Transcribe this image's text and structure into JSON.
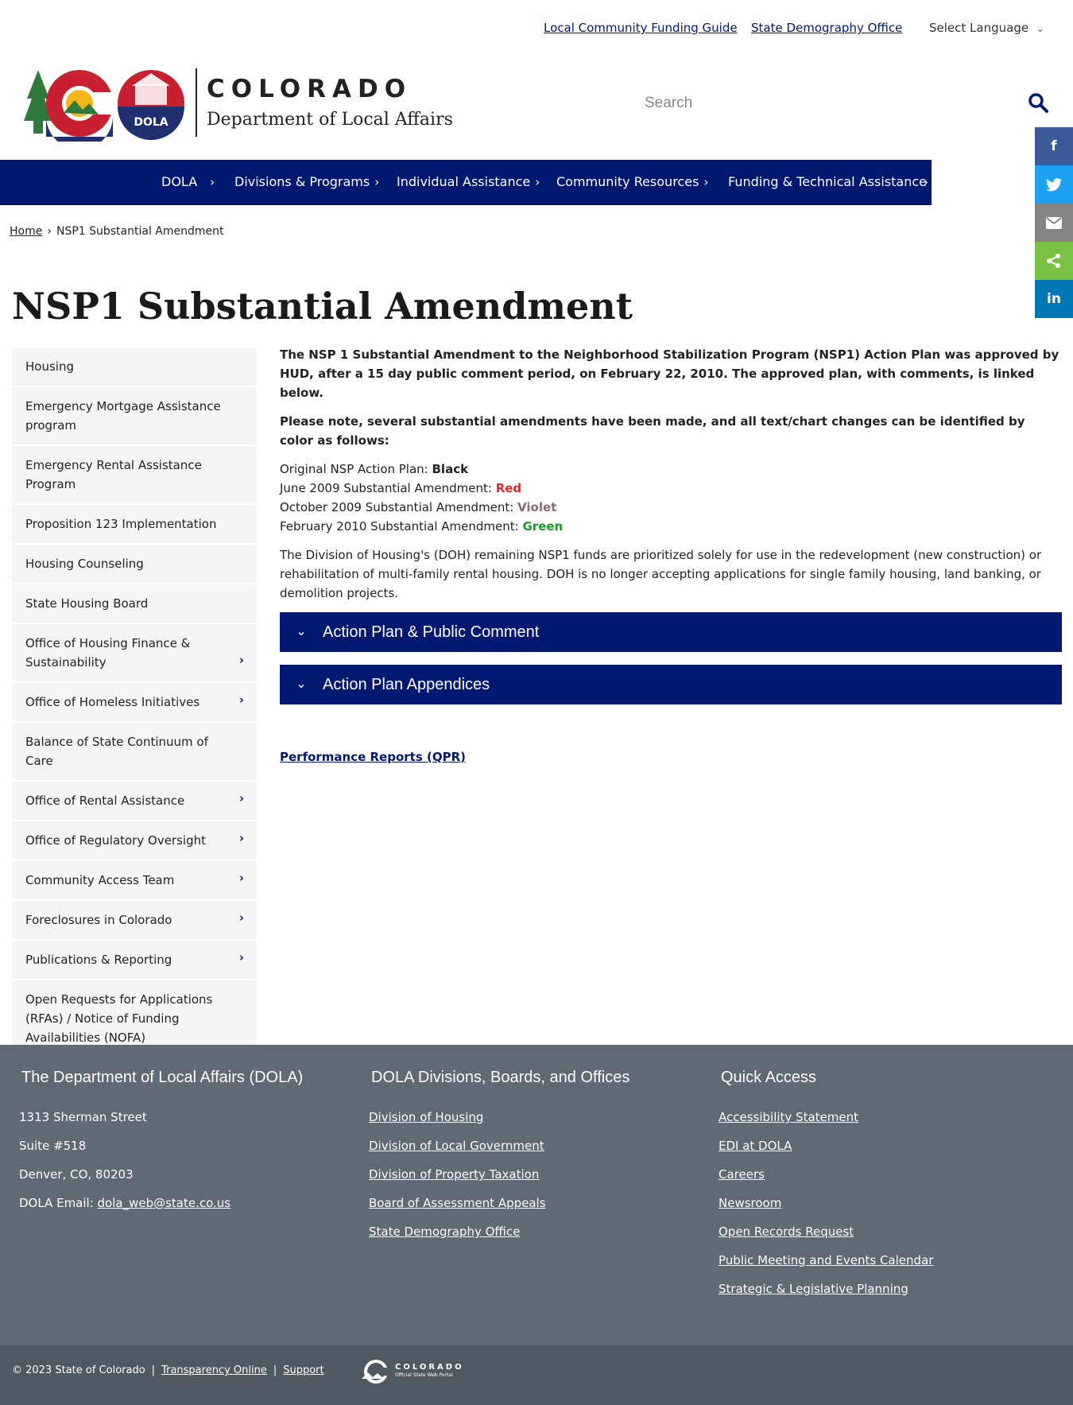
{
  "utility": {
    "link1": "Local Community Funding Guide",
    "link2": "State Demography Office",
    "language": "Select Language"
  },
  "header": {
    "logo_title": "COLORADO",
    "logo_subtitle": "Department of Local Affairs",
    "logo_badge": "DOLA",
    "search_placeholder": "Search"
  },
  "nav": {
    "items": [
      {
        "label": "DOLA"
      },
      {
        "label": "Divisions & Programs"
      },
      {
        "label": "Individual Assistance"
      },
      {
        "label": "Community Resources"
      },
      {
        "label": "Funding & Technical Assistance"
      }
    ]
  },
  "share": {
    "facebook": "f",
    "linkedin": "in"
  },
  "breadcrumb": {
    "home": "Home",
    "current": "NSP1 Substantial Amendment"
  },
  "page_title": "NSP1 Substantial Amendment",
  "sidemenu": {
    "items": [
      {
        "label": "Housing"
      },
      {
        "label": "Emergency Mortgage Assistance program"
      },
      {
        "label": "Emergency Rental Assistance Program"
      },
      {
        "label": "Proposition 123 Implementation"
      },
      {
        "label": "Housing Counseling"
      },
      {
        "label": "State Housing Board"
      },
      {
        "label": "Office of Housing Finance & Sustainability"
      },
      {
        "label": "Office of Homeless Initiatives"
      },
      {
        "label": "Balance of State Continuum of Care"
      },
      {
        "label": "Office of Rental Assistance"
      },
      {
        "label": "Office of Regulatory Oversight"
      },
      {
        "label": "Community Access Team"
      },
      {
        "label": "Foreclosures in Colorado"
      },
      {
        "label": "Publications & Reporting"
      },
      {
        "label": "Open Requests for Applications (RFAs) / Notice of Funding Availabilities (NOFA)"
      }
    ]
  },
  "main": {
    "intro": "The NSP 1 Substantial Amendment to the Neighborhood Stabilization Program (NSP1) Action Plan was approved by HUD, after a 15 day public comment period, on February 22, 2010. The approved plan, with comments, is linked below.",
    "note": "Please note, several substantial amendments have been made, and all text/chart changes can be identified by color as follows:",
    "legend": {
      "l1": "Original NSP Action Plan: ",
      "v1": "Black",
      "l2": "June 2009 Substantial Amendment: ",
      "v2": "Red",
      "l3": "October 2009 Substantial Amendment: ",
      "v3": "Violet",
      "l4": "February 2010 Substantial Amendment: ",
      "v4": "Green"
    },
    "doh_text": "The Division of Housing's (DOH) remaining NSP1 funds are prioritized solely for use in the redevelopment (new construction) or rehabilitation of multi-family rental housing. DOH is no longer accepting applications for single family housing, land banking, or demolition projects.",
    "accordion1": "Action Plan & Public Comment",
    "accordion2": "Action Plan Appendices",
    "perf_link": "Performance Reports (QPR)"
  },
  "footer": {
    "col1": {
      "title": "The Department of Local Affairs (DOLA)",
      "address1": "1313 Sherman Street",
      "address2": "Suite  #518",
      "address3": "Denver, CO, 80203",
      "email_label": "DOLA Email: ",
      "email": "dola_web@state.co.us"
    },
    "col2": {
      "title": "DOLA Divisions, Boards, and Offices",
      "links": [
        "Division of Housing",
        "Division of Local Government",
        "Division of Property Taxation",
        "Board of Assessment Appeals",
        "State Demography Office"
      ]
    },
    "col3": {
      "title": "Quick Access",
      "links": [
        "Accessibility Statement",
        "EDI at DOLA",
        "Careers",
        "Newsroom",
        "Open Records Request",
        "Public Meeting and Events Calendar",
        "Strategic & Legislative Planning"
      ]
    }
  },
  "bottom": {
    "copyright": "© 2023 State of Colorado",
    "transparency": "Transparency Online",
    "support": "Support",
    "portal_title": "COLORADO",
    "portal_subtitle": "Official State Web Portal"
  },
  "colors": {
    "brand_navy": "#001970",
    "footer_bg": "#5f6a74",
    "red": "#e0282f",
    "violet": "#8a6a72",
    "green": "#1a9a26"
  }
}
